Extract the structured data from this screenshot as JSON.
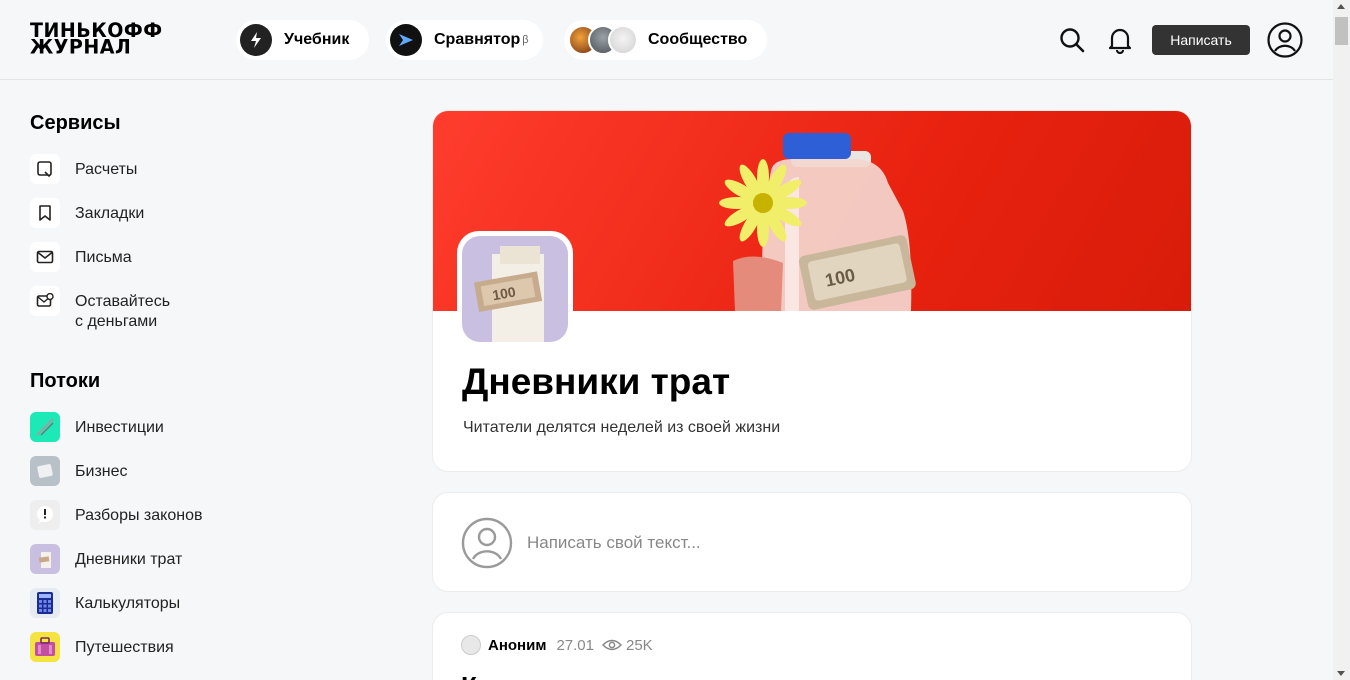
{
  "header": {
    "logo_line1": "ТИНЬКОФФ",
    "logo_line2": "ЖУРНАЛ",
    "nav": {
      "textbook": "Учебник",
      "comparator": "Сравнятор",
      "comparator_sup": "β",
      "community": "Сообщество"
    },
    "write_label": "Написать"
  },
  "sidebar": {
    "services_heading": "Сервисы",
    "services": [
      {
        "label": "Расчеты",
        "icon": "calc-icon"
      },
      {
        "label": "Закладки",
        "icon": "bookmark-icon"
      },
      {
        "label": "Письма",
        "icon": "mail-icon"
      },
      {
        "label_line1": "Оставайтесь",
        "label_line2": "с деньгами",
        "icon": "wallet-mail-icon"
      }
    ],
    "streams_heading": "Потоки",
    "streams": [
      {
        "label": "Инвестиции",
        "color": "#1de9b6"
      },
      {
        "label": "Бизнес",
        "color": "#b8c0c8"
      },
      {
        "label": "Разборы законов",
        "color": "#eeeeee"
      },
      {
        "label": "Дневники трат",
        "color": "#c9bfe0"
      },
      {
        "label": "Калькуляторы",
        "color": "#e6eaf2"
      },
      {
        "label": "Путешествия",
        "color": "#f5e342"
      }
    ]
  },
  "stream": {
    "title": "Дневники трат",
    "description": "Читатели делятся неделей из своей жизни",
    "banner_color": "#e8220f",
    "bill_label": "100"
  },
  "compose": {
    "placeholder": "Написать свой текст..."
  },
  "post": {
    "author": "Аноним",
    "date": "27.01",
    "views": "25K",
    "title": "К"
  }
}
